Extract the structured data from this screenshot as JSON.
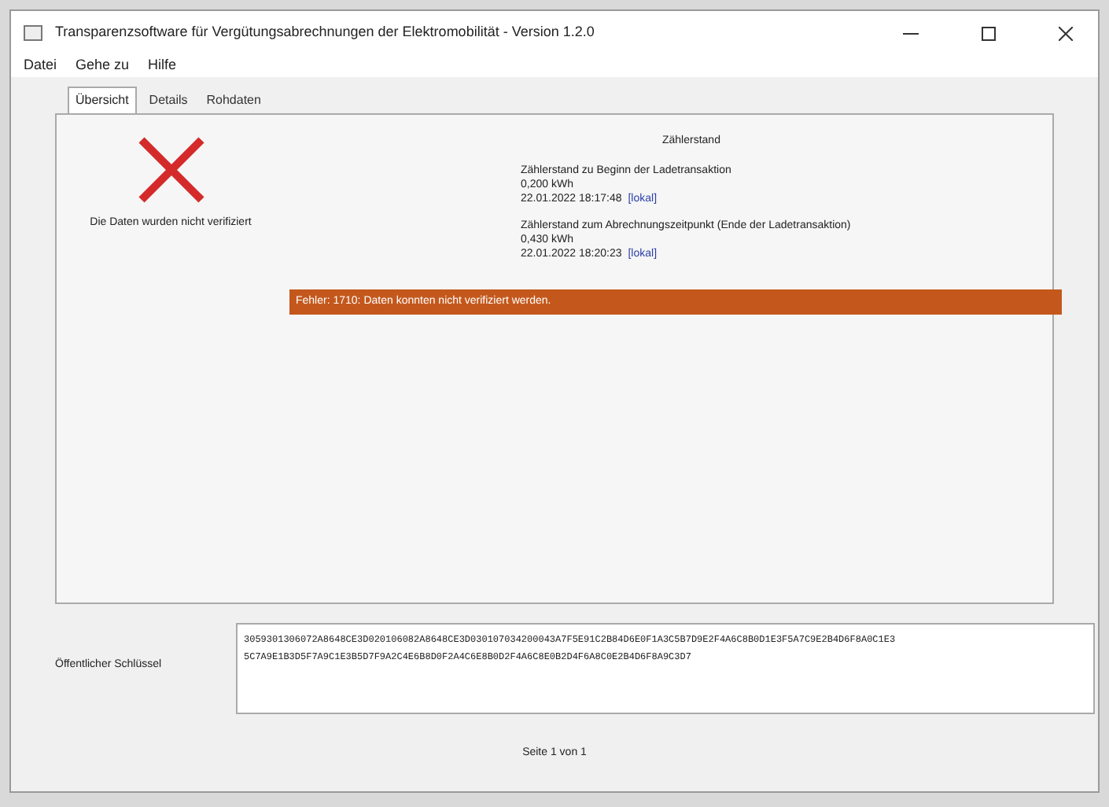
{
  "window": {
    "title": "Transparenzsoftware für Vergütungsabrechnungen der Elektromobilität - Version 1.2.0"
  },
  "menu": [
    "Datei",
    "Gehe zu",
    "Hilfe"
  ],
  "tabs": [
    {
      "label": "Übersicht",
      "selected": true
    },
    {
      "label": "Details",
      "selected": false
    },
    {
      "label": "Rohdaten",
      "selected": false
    }
  ],
  "verification": {
    "verified": false,
    "message": "Die Daten wurden nicht verifiziert"
  },
  "meter": {
    "heading": "Zählerstand",
    "entries": [
      {
        "label": "Zählerstand zu Beginn der Ladetransaktion",
        "value": "0,200 kWh",
        "time": "22.01.2022 18:17:48",
        "zone": "[lokal]"
      },
      {
        "label": "Zählerstand zum Abrechnungszeitpunkt (Ende der Ladetransaktion)",
        "value": "0,430 kWh",
        "time": "22.01.2022 18:20:23",
        "zone": "[lokal]"
      }
    ]
  },
  "error": "Fehler: 1710: Daten konnten nicht verifiziert werden.",
  "public_key": {
    "label": "Öffentlicher Schlüssel",
    "value": [
      "3059301306072A8648CE3D020106082A8648CE3D030107034200043A7F5E91C2B84D6E0F1A3C5B7D9E2F4A6C8B0D1E3F5A7C9E2B4D6F8A0C1E3",
      "5C7A9E1B3D5F7A9C1E3B5D7F9A2C4E6B8D0F2A4C6E8B0D2F4A6C8E0B2D4F6A8C0E2B4D6F8A9C3D7"
    ]
  },
  "page": "Seite 1 von 1"
}
